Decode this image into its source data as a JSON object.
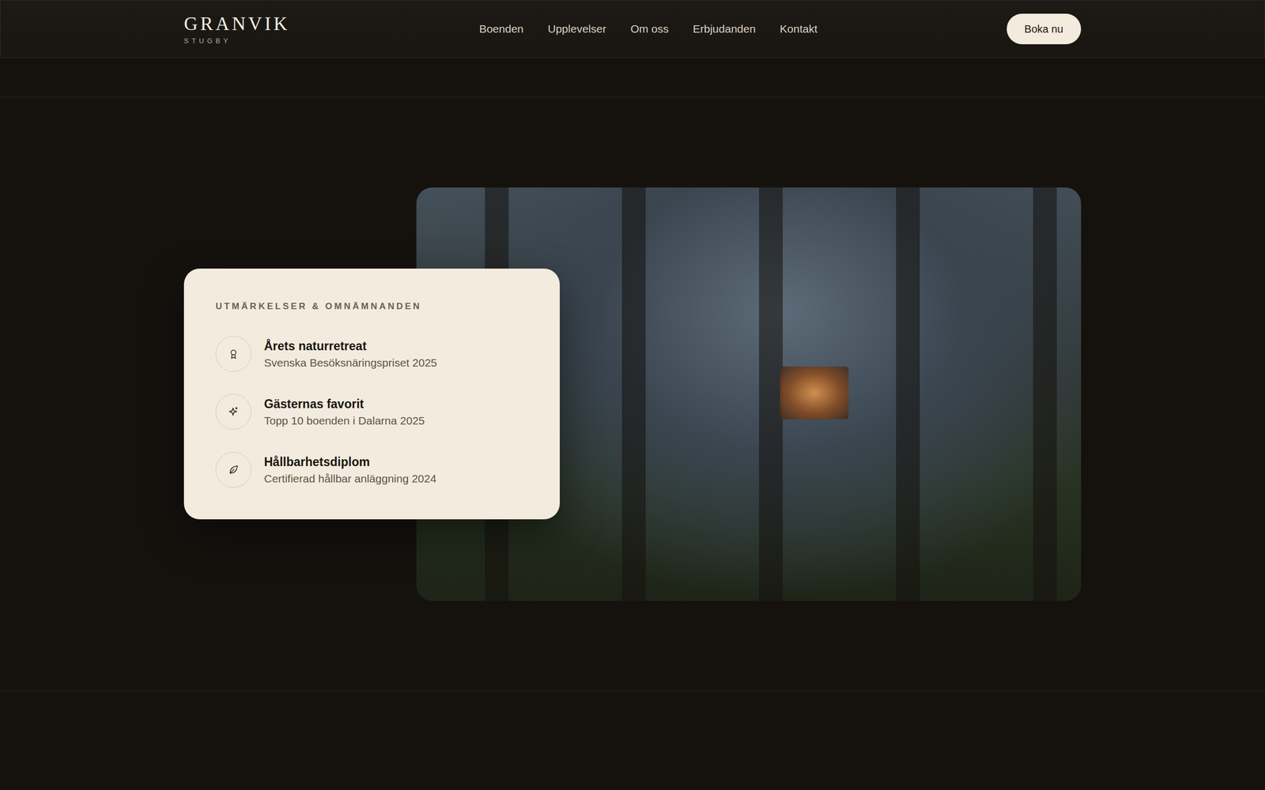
{
  "header": {
    "logo": {
      "name": "GRANVIK",
      "tagline": "STUGBY"
    },
    "nav": [
      {
        "label": "Boenden"
      },
      {
        "label": "Upplevelser"
      },
      {
        "label": "Om oss"
      },
      {
        "label": "Erbjudanden"
      },
      {
        "label": "Kontakt"
      }
    ],
    "cta": "Boka nu"
  },
  "awards": {
    "title": "UTMÄRKELSER & OMNÄMNANDEN",
    "items": [
      {
        "title": "Årets naturretreat",
        "subtitle": "Svenska Besöksnäringspriset 2025"
      },
      {
        "title": "Gästernas favorit",
        "subtitle": "Topp 10 boenden i Dalarna 2025"
      },
      {
        "title": "Hållbarhetsdiplom",
        "subtitle": "Certifierad hållbar anläggning 2024"
      }
    ]
  }
}
